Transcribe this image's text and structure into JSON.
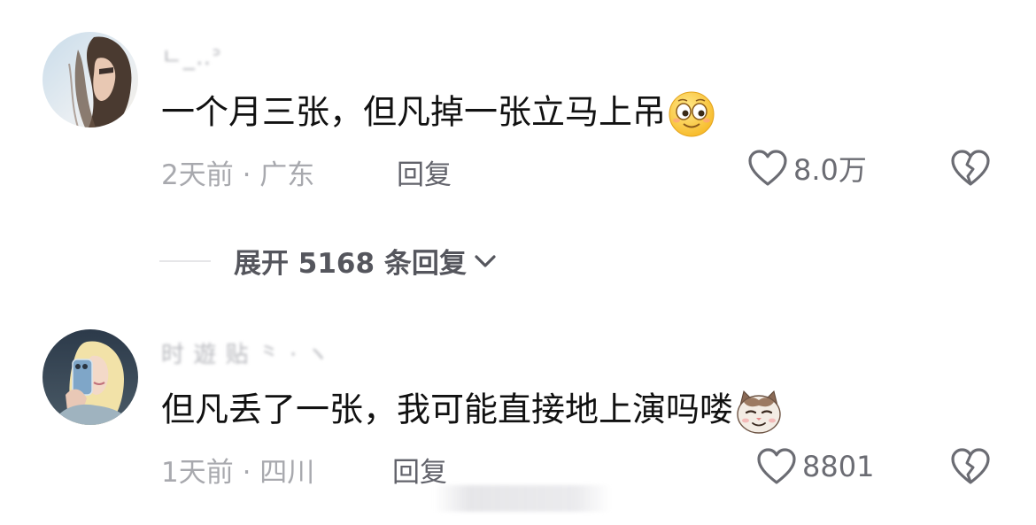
{
  "comments": [
    {
      "username": "ㄴ_‥ᐣ",
      "text": "一个月三张，但凡掉一张立马上吊",
      "emoji": "smiling-eyes-emoji",
      "time_location": "2天前 · 广东",
      "reply_label": "回复",
      "like_count": "8.0万"
    },
    {
      "username": "时 遊 贴 ⺀ ·  ヽ",
      "text": "但凡丢了一张，我可能直接地上演吗喽",
      "emoji": "smug-cat-emoji",
      "time_location": "1天前 · 四川",
      "reply_label": "回复",
      "like_count": "8801"
    }
  ],
  "expand_replies": {
    "label": "展开 5168 条回复"
  },
  "icons": {
    "like": "heart-outline-icon",
    "dislike": "broken-heart-icon",
    "expand": "chevron-down-icon"
  },
  "colors": {
    "text_primary": "#111111",
    "text_meta": "#a8a9ae",
    "icon": "#6b6c73"
  }
}
